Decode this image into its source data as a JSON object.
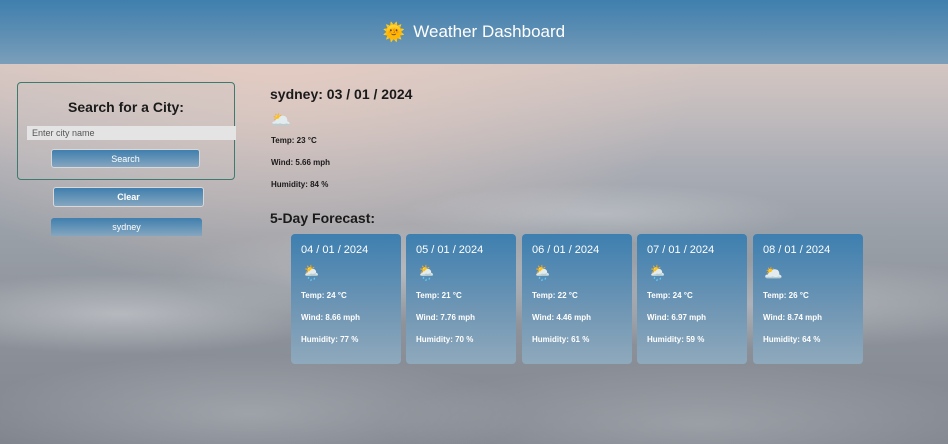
{
  "header": {
    "title": "Weather Dashboard",
    "logo_icon": "sun-icon"
  },
  "search": {
    "title": "Search for a City:",
    "placeholder": "Enter city name",
    "button_label": "Search",
    "clear_label": "Clear",
    "history": [
      "sydney"
    ]
  },
  "current": {
    "heading": "sydney: 03 / 01 / 2024",
    "icon": "partly-cloudy-icon",
    "temp": "Temp: 23 °C",
    "wind": "Wind: 5.66 mph",
    "humidity": "Humidity: 84 %"
  },
  "forecast": {
    "title": "5-Day Forecast:",
    "days": [
      {
        "date": "04 / 01 / 2024",
        "icon": "rain-icon",
        "temp": "Temp: 24 °C",
        "wind": "Wind: 8.66 mph",
        "humidity": "Humidity: 77 %"
      },
      {
        "date": "05 / 01 / 2024",
        "icon": "rain-icon",
        "temp": "Temp: 21 °C",
        "wind": "Wind: 7.76 mph",
        "humidity": "Humidity: 70 %"
      },
      {
        "date": "06 / 01 / 2024",
        "icon": "rain-icon",
        "temp": "Temp: 22 °C",
        "wind": "Wind: 4.46 mph",
        "humidity": "Humidity: 61 %"
      },
      {
        "date": "07 / 01 / 2024",
        "icon": "rain-icon",
        "temp": "Temp: 24 °C",
        "wind": "Wind: 6.97 mph",
        "humidity": "Humidity: 59 %"
      },
      {
        "date": "08 / 01 / 2024",
        "icon": "partly-cloudy-icon",
        "temp": "Temp: 26 °C",
        "wind": "Wind: 8.74 mph",
        "humidity": "Humidity: 64 %"
      }
    ]
  },
  "colors": {
    "header": "#3f7fae",
    "card": "#3d7fb0",
    "panel_border": "#3e7a6e"
  }
}
